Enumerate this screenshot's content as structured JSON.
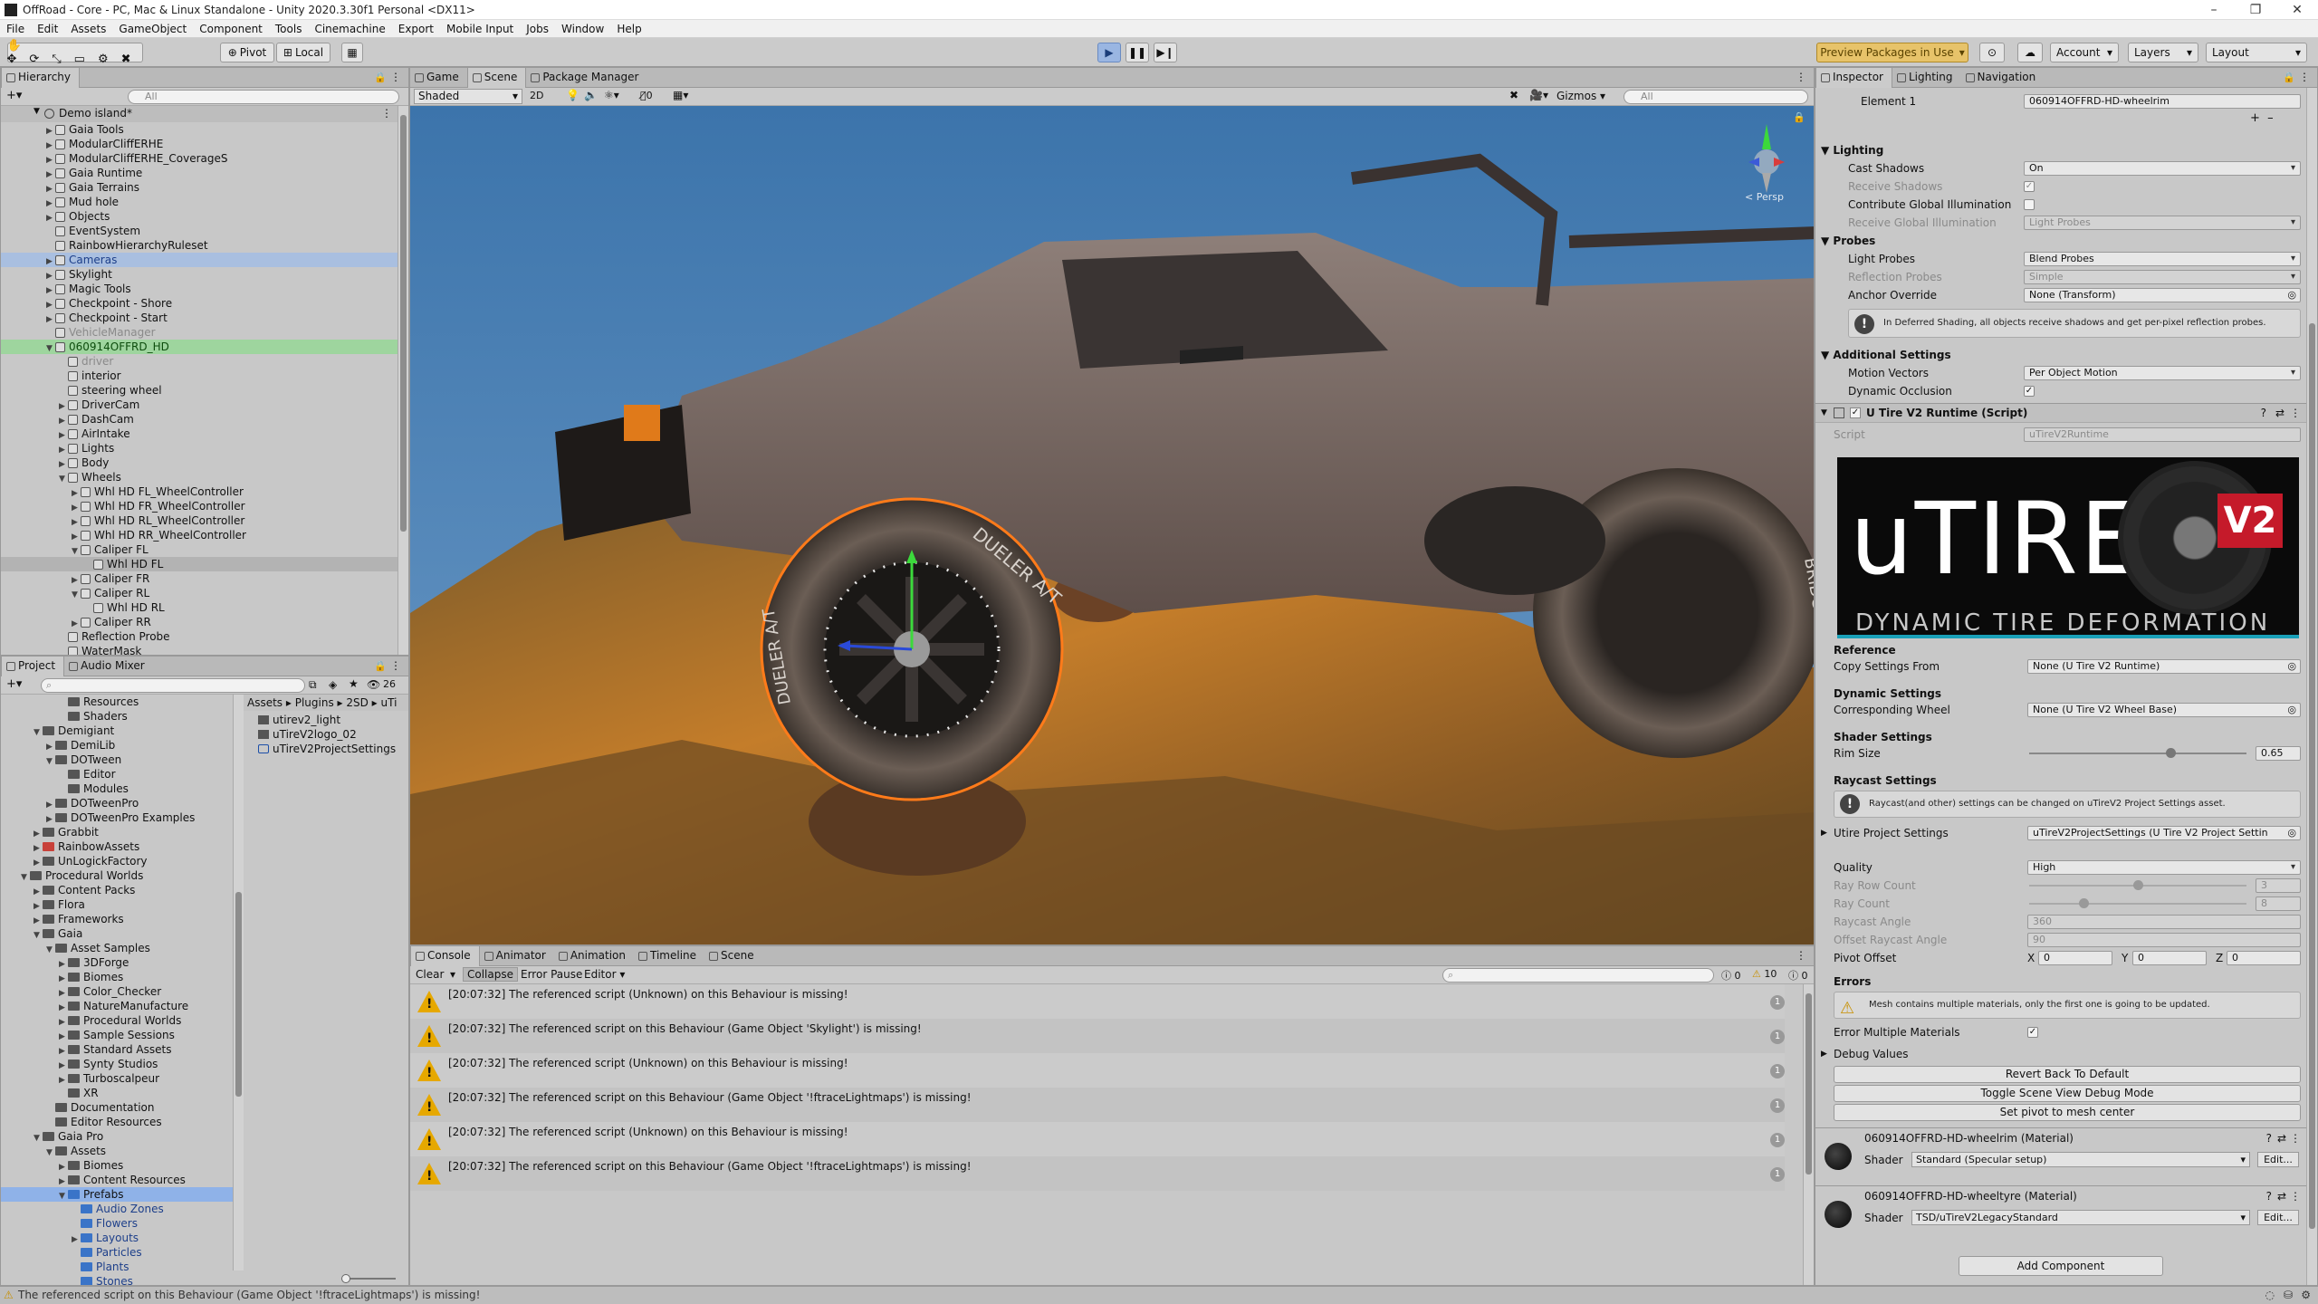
{
  "window": {
    "title": "OffRoad - Core - PC, Mac & Linux Standalone - Unity 2020.3.30f1 Personal <DX11>"
  },
  "menu": [
    "File",
    "Edit",
    "Assets",
    "GameObject",
    "Component",
    "Tools",
    "Cinemachine",
    "Export",
    "Mobile Input",
    "Jobs",
    "Window",
    "Help"
  ],
  "toolbar": {
    "pivot_label": "Pivot",
    "local_label": "Local",
    "preview_packages": "Preview Packages in Use",
    "account": "Account",
    "layers": "Layers",
    "layout": "Layout"
  },
  "hierarchy": {
    "tab": "Hierarchy",
    "search_placeholder": "All",
    "scene": "Demo island*",
    "items": [
      {
        "label": "Gaia Tools",
        "depth": 1,
        "arrow": "▶"
      },
      {
        "label": "ModularCliffERHE",
        "depth": 1,
        "arrow": "▶"
      },
      {
        "label": "ModularCliffERHE_CoverageS",
        "depth": 1,
        "arrow": "▶"
      },
      {
        "label": "Gaia Runtime",
        "depth": 1,
        "arrow": "▶"
      },
      {
        "label": "Gaia Terrains",
        "depth": 1,
        "arrow": "▶"
      },
      {
        "label": "Mud hole",
        "depth": 1,
        "arrow": "▶"
      },
      {
        "label": "Objects",
        "depth": 1,
        "arrow": "▶"
      },
      {
        "label": "EventSystem",
        "depth": 1,
        "arrow": ""
      },
      {
        "label": "RainbowHierarchyRuleset",
        "depth": 1,
        "arrow": ""
      },
      {
        "label": "Cameras",
        "depth": 1,
        "arrow": "▶",
        "style": "blue"
      },
      {
        "label": "Skylight",
        "depth": 1,
        "arrow": "▶"
      },
      {
        "label": "Magic Tools",
        "depth": 1,
        "arrow": "▶"
      },
      {
        "label": "Checkpoint - Shore",
        "depth": 1,
        "arrow": "▶"
      },
      {
        "label": "Checkpoint - Start",
        "depth": 1,
        "arrow": "▶"
      },
      {
        "label": "VehicleManager",
        "depth": 1,
        "arrow": "",
        "style": "grey"
      },
      {
        "label": "060914OFFRD_HD",
        "depth": 1,
        "arrow": "▼",
        "style": "green"
      },
      {
        "label": "driver",
        "depth": 2,
        "arrow": "",
        "style": "grey"
      },
      {
        "label": "interior",
        "depth": 2,
        "arrow": ""
      },
      {
        "label": "steering wheel",
        "depth": 2,
        "arrow": ""
      },
      {
        "label": "DriverCam",
        "depth": 2,
        "arrow": "▶"
      },
      {
        "label": "DashCam",
        "depth": 2,
        "arrow": "▶"
      },
      {
        "label": "AirIntake",
        "depth": 2,
        "arrow": "▶"
      },
      {
        "label": "Lights",
        "depth": 2,
        "arrow": "▶"
      },
      {
        "label": "Body",
        "depth": 2,
        "arrow": "▶"
      },
      {
        "label": "Wheels",
        "depth": 2,
        "arrow": "▼"
      },
      {
        "label": "Whl HD FL_WheelController",
        "depth": 3,
        "arrow": "▶"
      },
      {
        "label": "Whl HD FR_WheelController",
        "depth": 3,
        "arrow": "▶"
      },
      {
        "label": "Whl HD RL_WheelController",
        "depth": 3,
        "arrow": "▶"
      },
      {
        "label": "Whl HD RR_WheelController",
        "depth": 3,
        "arrow": "▶"
      },
      {
        "label": "Caliper FL",
        "depth": 3,
        "arrow": "▼"
      },
      {
        "label": "Whl HD FL",
        "depth": 4,
        "arrow": "",
        "style": "sel"
      },
      {
        "label": "Caliper FR",
        "depth": 3,
        "arrow": "▶"
      },
      {
        "label": "Caliper RL",
        "depth": 3,
        "arrow": "▼"
      },
      {
        "label": "Whl HD RL",
        "depth": 4,
        "arrow": ""
      },
      {
        "label": "Caliper RR",
        "depth": 3,
        "arrow": "▶"
      },
      {
        "label": "Reflection Probe",
        "depth": 2,
        "arrow": ""
      },
      {
        "label": "WaterMask",
        "depth": 2,
        "arrow": ""
      }
    ]
  },
  "project": {
    "tabs": [
      "Project",
      "Audio Mixer"
    ],
    "count": "26",
    "breadcrumb": [
      "Assets",
      "Plugins",
      "2SD",
      "uTi"
    ],
    "files": [
      "utirev2_light",
      "uTireV2logo_02",
      "uTireV2ProjectSettings"
    ],
    "tree": [
      {
        "label": "Resources",
        "depth": 3,
        "arrow": ""
      },
      {
        "label": "Shaders",
        "depth": 3,
        "arrow": ""
      },
      {
        "label": "Demigiant",
        "depth": 1,
        "arrow": "▼"
      },
      {
        "label": "DemiLib",
        "depth": 2,
        "arrow": "▶"
      },
      {
        "label": "DOTween",
        "depth": 2,
        "arrow": "▼"
      },
      {
        "label": "Editor",
        "depth": 3,
        "arrow": ""
      },
      {
        "label": "Modules",
        "depth": 3,
        "arrow": ""
      },
      {
        "label": "DOTweenPro",
        "depth": 2,
        "arrow": "▶"
      },
      {
        "label": "DOTweenPro Examples",
        "depth": 2,
        "arrow": "▶"
      },
      {
        "label": "Grabbit",
        "depth": 1,
        "arrow": "▶"
      },
      {
        "label": "RainbowAssets",
        "depth": 1,
        "arrow": "▶",
        "fold": "red"
      },
      {
        "label": "UnLogickFactory",
        "depth": 1,
        "arrow": "▶"
      },
      {
        "label": "Procedural Worlds",
        "depth": 0,
        "arrow": "▼"
      },
      {
        "label": "Content Packs",
        "depth": 1,
        "arrow": "▶"
      },
      {
        "label": "Flora",
        "depth": 1,
        "arrow": "▶"
      },
      {
        "label": "Frameworks",
        "depth": 1,
        "arrow": "▶"
      },
      {
        "label": "Gaia",
        "depth": 1,
        "arrow": "▼"
      },
      {
        "label": "Asset Samples",
        "depth": 2,
        "arrow": "▼"
      },
      {
        "label": "3DForge",
        "depth": 3,
        "arrow": "▶"
      },
      {
        "label": "Biomes",
        "depth": 3,
        "arrow": "▶"
      },
      {
        "label": "Color_Checker",
        "depth": 3,
        "arrow": "▶"
      },
      {
        "label": "NatureManufacture",
        "depth": 3,
        "arrow": "▶"
      },
      {
        "label": "Procedural Worlds",
        "depth": 3,
        "arrow": "▶"
      },
      {
        "label": "Sample Sessions",
        "depth": 3,
        "arrow": "▶"
      },
      {
        "label": "Standard Assets",
        "depth": 3,
        "arrow": "▶"
      },
      {
        "label": "Synty Studios",
        "depth": 3,
        "arrow": "▶"
      },
      {
        "label": "Turboscalpeur",
        "depth": 3,
        "arrow": "▶"
      },
      {
        "label": "XR",
        "depth": 3,
        "arrow": ""
      },
      {
        "label": "Documentation",
        "depth": 2,
        "arrow": ""
      },
      {
        "label": "Editor Resources",
        "depth": 2,
        "arrow": ""
      },
      {
        "label": "Gaia Pro",
        "depth": 1,
        "arrow": "▼"
      },
      {
        "label": "Assets",
        "depth": 2,
        "arrow": "▼"
      },
      {
        "label": "Biomes",
        "depth": 3,
        "arrow": "▶"
      },
      {
        "label": "Content Resources",
        "depth": 3,
        "arrow": "▶"
      },
      {
        "label": "Prefabs",
        "depth": 3,
        "arrow": "▼",
        "style": "selblue",
        "fold": "blue"
      },
      {
        "label": "Audio Zones",
        "depth": 4,
        "arrow": "",
        "style": "blue",
        "fold": "blue"
      },
      {
        "label": "Flowers",
        "depth": 4,
        "arrow": "",
        "style": "blue",
        "fold": "blue"
      },
      {
        "label": "Layouts",
        "depth": 4,
        "arrow": "▶",
        "style": "blue",
        "fold": "blue"
      },
      {
        "label": "Particles",
        "depth": 4,
        "arrow": "",
        "style": "blue",
        "fold": "blue"
      },
      {
        "label": "Plants",
        "depth": 4,
        "arrow": "",
        "style": "blue",
        "fold": "blue"
      },
      {
        "label": "Stones",
        "depth": 4,
        "arrow": "",
        "style": "blue",
        "fold": "blue"
      }
    ]
  },
  "scene_view": {
    "tabs": [
      "Game",
      "Scene",
      "Package Manager"
    ],
    "shading": "Shaded",
    "mode_2d": "2D",
    "fx_count": "0",
    "gizmos": "Gizmos",
    "search_placeholder": "All",
    "persp": "< Persp",
    "tire_text_1": "DUELER A/T",
    "tire_text_2": "DUELER A/T",
    "tire_text_3": "BRIDGE"
  },
  "console": {
    "tabs": [
      "Console",
      "Animator",
      "Animation",
      "Timeline",
      "Scene"
    ],
    "buttons": [
      "Clear",
      "Collapse",
      "Error Pause",
      "Editor"
    ],
    "counts": {
      "info": "0",
      "warn": "10",
      "error": "0"
    },
    "messages": [
      {
        "text": "[20:07:32] The referenced script (Unknown) on this Behaviour is missing!",
        "count": "1"
      },
      {
        "text": "[20:07:32] The referenced script on this Behaviour (Game Object 'Skylight') is missing!",
        "count": "1"
      },
      {
        "text": "[20:07:32] The referenced script (Unknown) on this Behaviour is missing!",
        "count": "1"
      },
      {
        "text": "[20:07:32] The referenced script on this Behaviour (Game Object '!ftraceLightmaps') is missing!",
        "count": "1"
      },
      {
        "text": "[20:07:32] The referenced script (Unknown) on this Behaviour is missing!",
        "count": "1"
      },
      {
        "text": "[20:07:32] The referenced script on this Behaviour (Game Object '!ftraceLightmaps') is missing!",
        "count": "1"
      }
    ]
  },
  "inspector": {
    "tabs": [
      "Inspector",
      "Lighting",
      "Navigation"
    ],
    "element1_label": "Element 1",
    "element1_value": "060914OFFRD-HD-wheelrim",
    "lighting_header": "Lighting",
    "cast_shadows": {
      "label": "Cast Shadows",
      "value": "On"
    },
    "receive_shadows": {
      "label": "Receive Shadows"
    },
    "contribute_gi": {
      "label": "Contribute Global Illumination"
    },
    "receive_gi": {
      "label": "Receive Global Illumination",
      "value": "Light Probes"
    },
    "probes_header": "Probes",
    "light_probes": {
      "label": "Light Probes",
      "value": "Blend Probes"
    },
    "reflection_probes": {
      "label": "Reflection Probes",
      "value": "Simple"
    },
    "anchor_override": {
      "label": "Anchor Override",
      "value": "None (Transform)"
    },
    "deferred_help": "In Deferred Shading, all objects receive shadows and get per-pixel reflection probes.",
    "additional_header": "Additional Settings",
    "motion_vectors": {
      "label": "Motion Vectors",
      "value": "Per Object Motion"
    },
    "dynamic_occlusion": {
      "label": "Dynamic Occlusion"
    },
    "utire_component": "U Tire V2 Runtime (Script)",
    "script": {
      "label": "Script",
      "value": "uTireV2Runtime"
    },
    "banner": {
      "title": "uTIRE",
      "badge": "V2",
      "subtitle": "DYNAMIC TIRE DEFORMATION"
    },
    "reference_header": "Reference",
    "copy_settings": {
      "label": "Copy Settings From",
      "value": "None (U Tire V2 Runtime)"
    },
    "dynamic_header": "Dynamic Settings",
    "corresponding_wheel": {
      "label": "Corresponding Wheel",
      "value": "None (U Tire V2 Wheel Base)"
    },
    "shader_header": "Shader Settings",
    "rim_size": {
      "label": "Rim Size",
      "value": "0.65",
      "fraction": 0.65
    },
    "raycast_header": "Raycast Settings",
    "raycast_help": "Raycast(and other) settings can be changed on uTireV2 Project Settings asset.",
    "utire_project_settings": {
      "label": "Utire Project Settings",
      "value": "uTireV2ProjectSettings (U Tire V2 Project Settin"
    },
    "quality": {
      "label": "Quality",
      "value": "High"
    },
    "ray_row_count": {
      "label": "Ray Row Count",
      "value": "3",
      "fraction": 0.5
    },
    "ray_count": {
      "label": "Ray Count",
      "value": "8",
      "fraction": 0.25
    },
    "raycast_angle": {
      "label": "Raycast Angle",
      "value": "360"
    },
    "offset_raycast_angle": {
      "label": "Offset Raycast Angle",
      "value": "90"
    },
    "pivot_offset": {
      "label": "Pivot Offset",
      "x": "0",
      "y": "0",
      "z": "0"
    },
    "errors_header": "Errors",
    "errors_help": "Mesh contains multiple materials, only the first one is going to be updated.",
    "error_multiple": {
      "label": "Error Multiple Materials"
    },
    "debug_values": "Debug Values",
    "btn_revert": "Revert Back To Default",
    "btn_toggle_debug": "Toggle Scene View Debug Mode",
    "btn_set_pivot": "Set pivot to mesh center",
    "mat1": {
      "name": "060914OFFRD-HD-wheelrim (Material)",
      "shader_label": "Shader",
      "shader": "Standard (Specular setup)",
      "edit": "Edit..."
    },
    "mat2": {
      "name": "060914OFFRD-HD-wheeltyre (Material)",
      "shader_label": "Shader",
      "shader": "TSD/uTireV2LegacyStandard",
      "edit": "Edit..."
    },
    "add_component": "Add Component"
  },
  "status": {
    "text": "The referenced script on this Behaviour (Game Object '!ftraceLightmaps') is missing!"
  }
}
